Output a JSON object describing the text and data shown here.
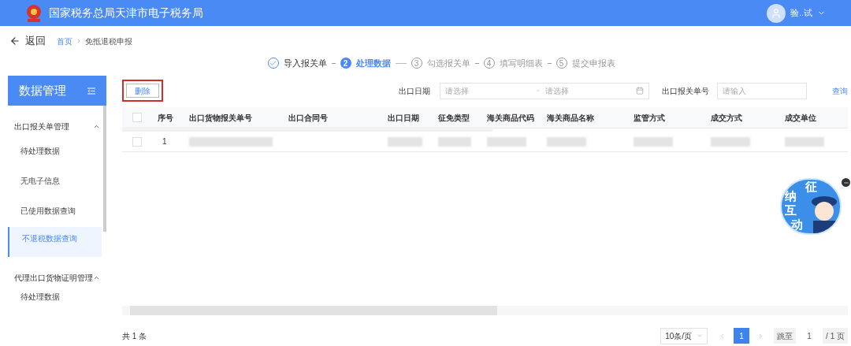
{
  "header": {
    "title": "国家税务总局天津市电子税务局",
    "user": "验..试"
  },
  "nav": {
    "back": "返回",
    "breadcrumb": [
      {
        "label": "首页",
        "link": true
      },
      {
        "label": "免抵退税申报",
        "link": false
      }
    ]
  },
  "steps": [
    {
      "label": "导入报关单",
      "completed": true,
      "selected": false
    },
    {
      "number": "2",
      "label": "处理数据",
      "completed": false,
      "selected": true
    },
    {
      "number": "3",
      "label": "勾选报关单",
      "completed": false,
      "selected": false
    },
    {
      "number": "4",
      "label": "填写明细表",
      "completed": false,
      "selected": false
    },
    {
      "number": "5",
      "label": "提交申报表",
      "completed": false,
      "selected": false
    }
  ],
  "sidebar": {
    "title": "数据管理",
    "groups": [
      {
        "label": "出口报关单管理",
        "expanded": true,
        "items": [
          {
            "label": "待处理数据",
            "selected": false
          },
          {
            "label": "无电子信息",
            "selected": false
          },
          {
            "label": "已使用数据查询",
            "selected": false
          },
          {
            "label": "不退税数据查询",
            "selected": true
          }
        ]
      },
      {
        "label": "代理出口货物证明管理",
        "expanded": true,
        "items": [
          {
            "label": "待处理数据",
            "selected": false
          }
        ]
      }
    ]
  },
  "toolbar": {
    "delete_button": {
      "label": "删除",
      "highlighted": true
    },
    "date_label": "出口日期",
    "date_from_placeholder": "请选择",
    "date_to_placeholder": "请选择",
    "number_label": "出口报关单号",
    "number_placeholder": "请输入",
    "query": "查询"
  },
  "table": {
    "all_checked": false,
    "columns": [
      "序号",
      "出口货物报关单号",
      "出口合同号",
      "出口日期",
      "征免类型",
      "海关商品代码",
      "海关商品名称",
      "监管方式",
      "成交方式",
      "成交单位"
    ],
    "rows": [
      {
        "checked": false,
        "index": "1",
        "blurred": [
          true,
          false,
          true,
          true,
          true,
          true,
          true,
          true,
          true
        ]
      }
    ]
  },
  "footer": {
    "total": "共 1 条",
    "page_size": "10条/页",
    "pages": [
      {
        "label": "1",
        "selected": true
      }
    ],
    "jump_label": "跳至",
    "jump_value": "1",
    "page_total": "/ 1 页"
  },
  "assistant": {
    "chars": [
      "征",
      "纳",
      "互",
      "动"
    ]
  }
}
